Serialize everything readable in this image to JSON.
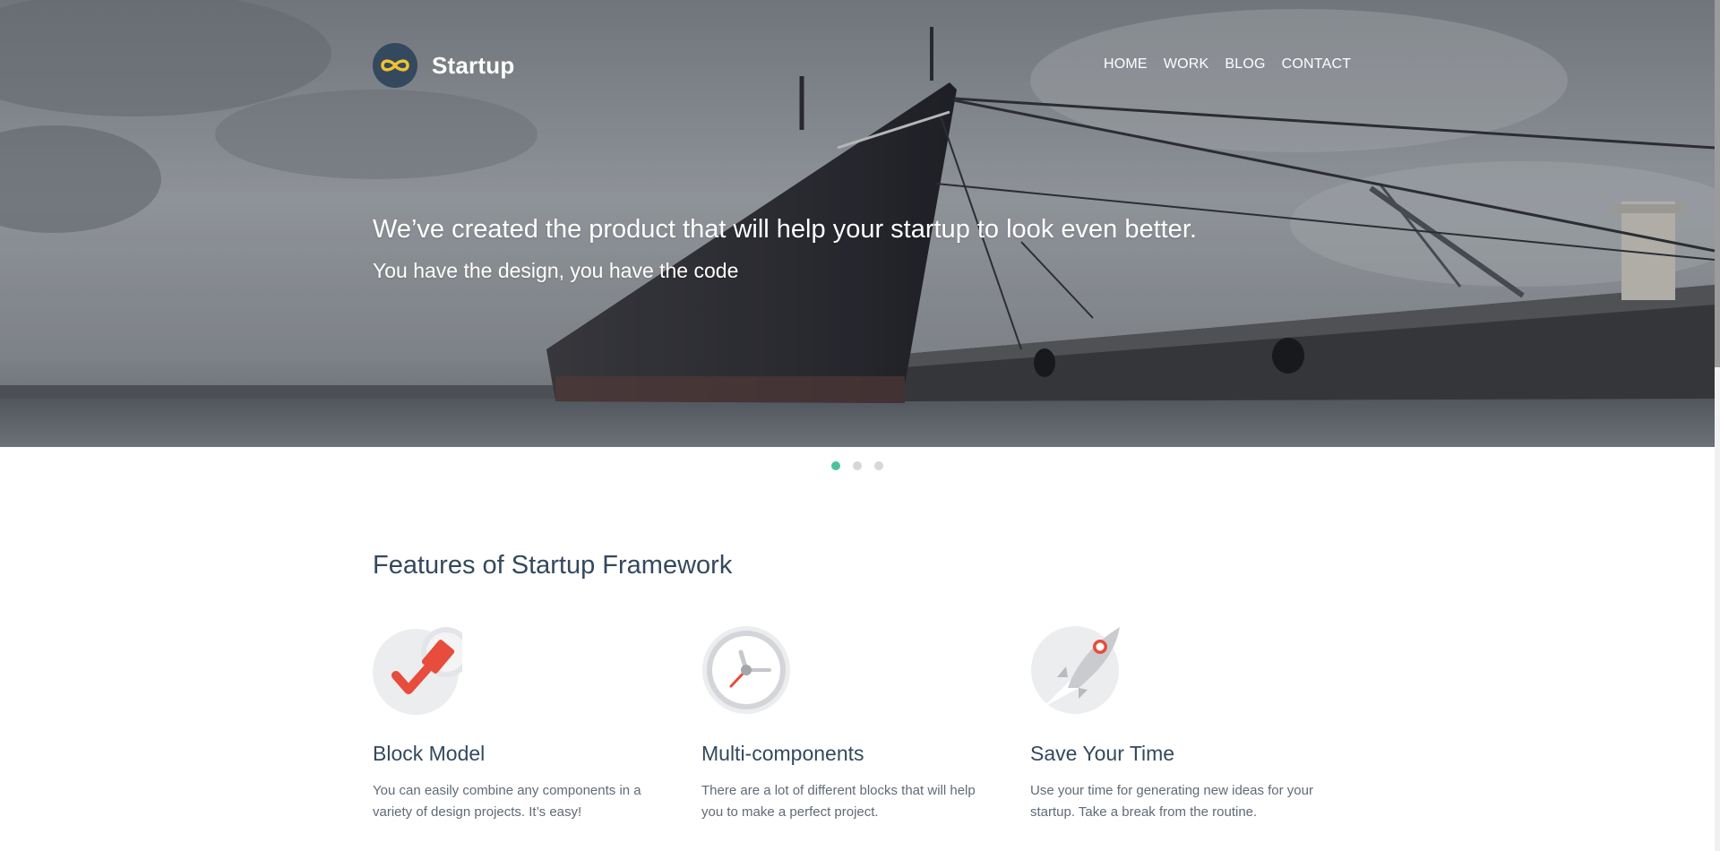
{
  "header": {
    "brand": "Startup",
    "nav": [
      "HOME",
      "WORK",
      "BLOG",
      "CONTACT"
    ]
  },
  "hero": {
    "title": "We’ve created the product that will help your startup to look even better.",
    "subtitle": "You have the design, you have the code"
  },
  "slider": {
    "total_slides": 3,
    "active_slide": 1
  },
  "features": {
    "title": "Features of Startup Framework",
    "items": [
      {
        "icon": "checkmark-marker-icon",
        "title": "Block Model",
        "text": "You can easily combine any components in a variety of design projects. It’s easy!"
      },
      {
        "icon": "clock-icon",
        "title": "Multi-components",
        "text": "There are a lot of different blocks that will help you to make a perfect project."
      },
      {
        "icon": "rocket-icon",
        "title": "Save Your Time",
        "text": "Use your time for generating new ideas for your startup. Take a break from the routine."
      }
    ]
  },
  "colors": {
    "accent": "#4ec39b",
    "heading": "#34495e",
    "body_text": "#5f6b77",
    "logo_badge": "#34495e",
    "logo_symbol": "#f2c22e",
    "icon_red": "#e74c3c",
    "icon_gray": "#ecedef"
  }
}
